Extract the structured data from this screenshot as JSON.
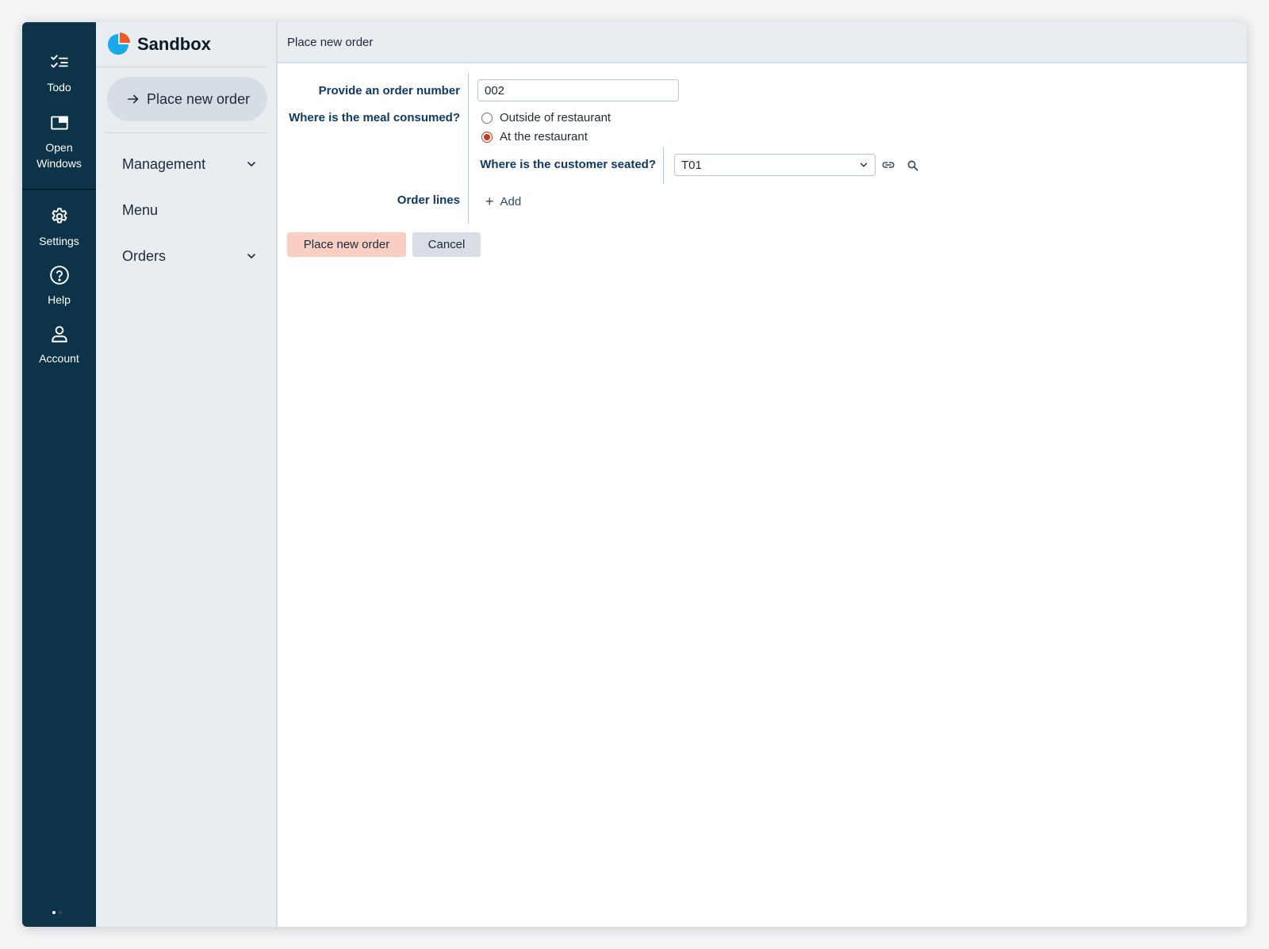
{
  "rail": {
    "items": [
      {
        "label": "Todo",
        "icon": "checklist-icon"
      },
      {
        "label": "Open\nWindows",
        "icon": "window-icon"
      },
      {
        "label": "Settings",
        "icon": "gear-icon"
      },
      {
        "label": "Help",
        "icon": "help-icon"
      },
      {
        "label": "Account",
        "icon": "user-icon"
      }
    ]
  },
  "nav": {
    "brand": "Sandbox",
    "primary_button": "Place new order",
    "items": [
      {
        "label": "Management",
        "expandable": true
      },
      {
        "label": "Menu",
        "expandable": false
      },
      {
        "label": "Orders",
        "expandable": true
      }
    ]
  },
  "page": {
    "title": "Place new order"
  },
  "form": {
    "order_number_label": "Provide an order number",
    "order_number_value": "002",
    "meal_label": "Where is the meal consumed?",
    "meal_options": [
      {
        "label": "Outside of restaurant",
        "checked": false
      },
      {
        "label": "At the restaurant",
        "checked": true
      }
    ],
    "seat_label": "Where is the customer seated?",
    "seat_value": "T01",
    "order_lines_label": "Order lines",
    "add_label": "Add",
    "submit_label": "Place new order",
    "cancel_label": "Cancel"
  },
  "colors": {
    "rail": "#0c3347",
    "accent": "#c23a1a",
    "label": "#0f3a66",
    "submit_bg": "#f9cfc4"
  }
}
